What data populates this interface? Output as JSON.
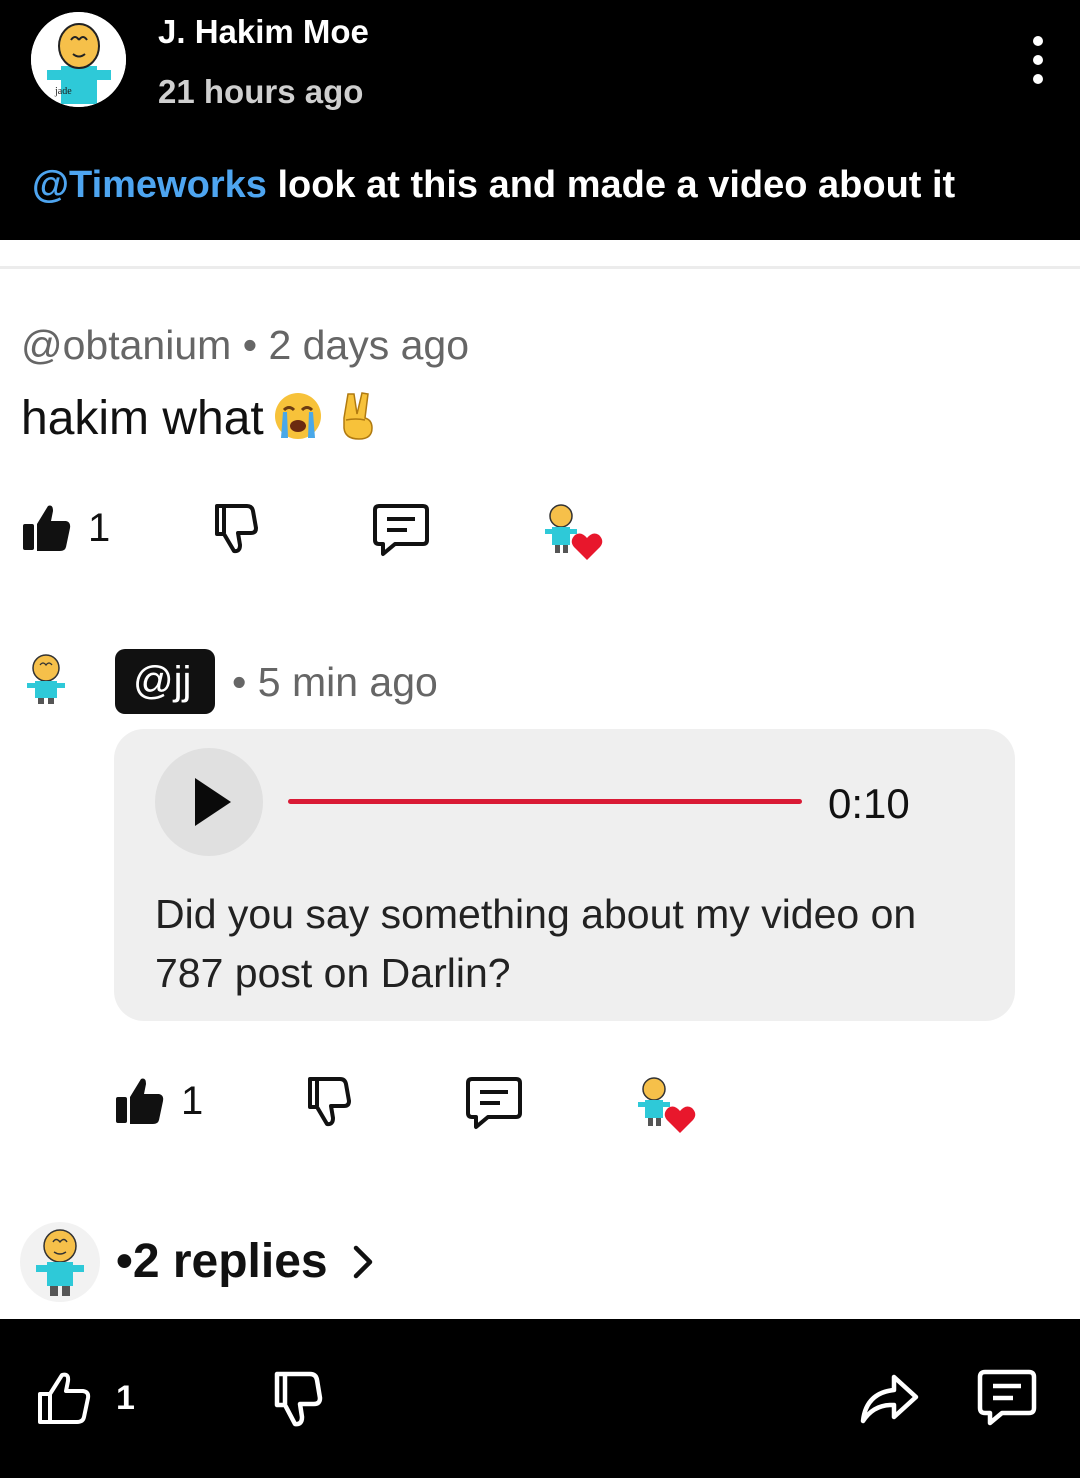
{
  "post": {
    "author": "J. Hakim Moe",
    "time": "21 hours ago",
    "mention": "@Timeworks",
    "text": " look at this and made a video about it"
  },
  "comment": {
    "author": "@obtanium",
    "separator": " • ",
    "time": "2 days ago",
    "text": "hakim what",
    "emojis": [
      "loudly-crying-face",
      "victory-hand"
    ],
    "like_count": "1"
  },
  "reply": {
    "handle": "@jj",
    "time_prefix": "• ",
    "time": "5 min ago",
    "voice_duration": "0:10",
    "voice_progress_percent": 100,
    "transcript": "Did you say something about my video on 787 post on Darlin?",
    "like_count": "1"
  },
  "replies_link": {
    "prefix": "• ",
    "label": "2 replies"
  },
  "bottom_bar": {
    "like_count": "1"
  },
  "colors": {
    "mention": "#4ea5f0",
    "progress": "#d91a35",
    "heart": "#e8172c",
    "avatar_shirt": "#2ec9d8"
  }
}
